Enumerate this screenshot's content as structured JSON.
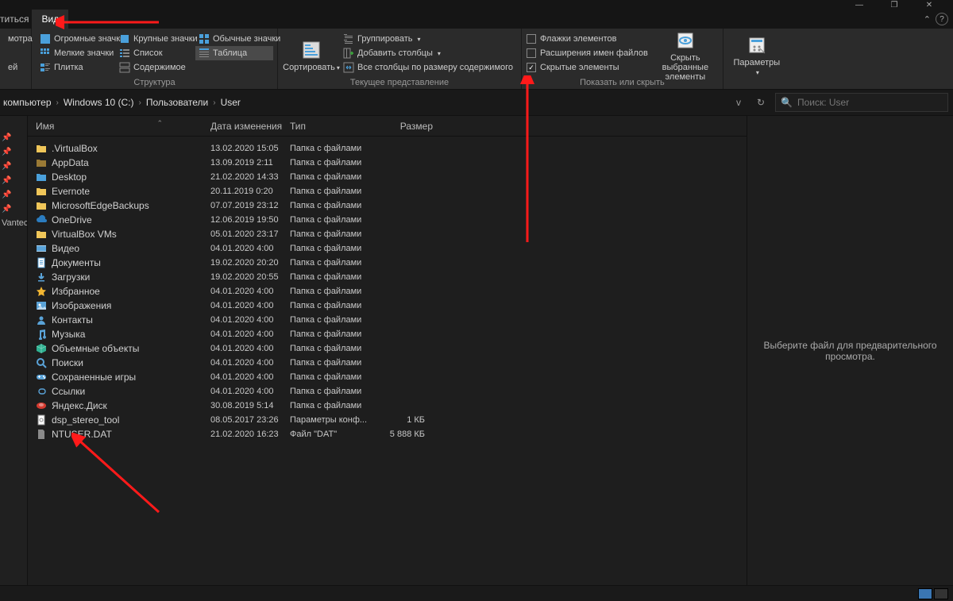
{
  "window": {
    "btn_minimize": "—",
    "btn_maximize": "❐",
    "btn_close": "✕"
  },
  "tabs": {
    "share_partial": "титься",
    "view": "Вид",
    "caret": "⌃",
    "help": "?"
  },
  "ribbon": {
    "sec_layout_label": "Структура",
    "sec_view_label": "Текущее представление",
    "sec_show_label": "Показать или скрыть",
    "pane_partial_1": "мотра",
    "pane_partial_2": "ей",
    "size_xl": "Огромные значки",
    "size_l": "Крупные значки",
    "size_m": "Обычные значки",
    "size_s": "Мелкие значки",
    "list": "Список",
    "table": "Таблица",
    "tiles": "Плитка",
    "content": "Содержимое",
    "sort": "Сортировать",
    "group": "Группировать",
    "add_cols": "Добавить столбцы",
    "autofit": "Все столбцы по размеру содержимого",
    "chk_flags": "Флажки элементов",
    "chk_ext": "Расширения имен файлов",
    "chk_hidden": "Скрытые элементы",
    "hide_selected_1": "Скрыть выбранные",
    "hide_selected_2": "элементы",
    "params": "Параметры"
  },
  "address": {
    "seg1": "компьютер",
    "seg2": "Windows 10 (C:)",
    "seg3": "Пользователи",
    "seg4": "User",
    "refresh": "↻",
    "drop": "v",
    "search_placeholder": "Поиск: User"
  },
  "columns": {
    "name": "Имя",
    "date": "Дата изменения",
    "type": "Тип",
    "size": "Размер"
  },
  "sidebar_partial": "Vantec",
  "files": [
    {
      "icon": "folder",
      "fill": "#f0c659",
      "name": ".VirtualBox",
      "date": "13.02.2020 15:05",
      "type": "Папка с файлами",
      "size": ""
    },
    {
      "icon": "folder",
      "fill": "#9a7a35",
      "name": "AppData",
      "date": "13.09.2019 2:11",
      "type": "Папка с файлами",
      "size": ""
    },
    {
      "icon": "folder",
      "fill": "#4aa0db",
      "name": "Desktop",
      "date": "21.02.2020 14:33",
      "type": "Папка с файлами",
      "size": ""
    },
    {
      "icon": "folder",
      "fill": "#f0c659",
      "name": "Evernote",
      "date": "20.11.2019 0:20",
      "type": "Папка с файлами",
      "size": ""
    },
    {
      "icon": "folder",
      "fill": "#f0c659",
      "name": "MicrosoftEdgeBackups",
      "date": "07.07.2019 23:12",
      "type": "Папка с файлами",
      "size": ""
    },
    {
      "icon": "cloud",
      "fill": "#2b7cbf",
      "name": "OneDrive",
      "date": "12.06.2019 19:50",
      "type": "Папка с файлами",
      "size": ""
    },
    {
      "icon": "folder",
      "fill": "#f0c659",
      "name": "VirtualBox VMs",
      "date": "05.01.2020 23:17",
      "type": "Папка с файлами",
      "size": ""
    },
    {
      "icon": "video",
      "fill": "#5aa3d8",
      "name": "Видео",
      "date": "04.01.2020 4:00",
      "type": "Папка с файлами",
      "size": ""
    },
    {
      "icon": "docs",
      "fill": "#5aa3d8",
      "name": "Документы",
      "date": "19.02.2020 20:20",
      "type": "Папка с файлами",
      "size": ""
    },
    {
      "icon": "download",
      "fill": "#5aa3d8",
      "name": "Загрузки",
      "date": "19.02.2020 20:55",
      "type": "Папка с файлами",
      "size": ""
    },
    {
      "icon": "star",
      "fill": "#f2b632",
      "name": "Избранное",
      "date": "04.01.2020 4:00",
      "type": "Папка с файлами",
      "size": ""
    },
    {
      "icon": "pictures",
      "fill": "#5aa3d8",
      "name": "Изображения",
      "date": "04.01.2020 4:00",
      "type": "Папка с файлами",
      "size": ""
    },
    {
      "icon": "contacts",
      "fill": "#5aa3d8",
      "name": "Контакты",
      "date": "04.01.2020 4:00",
      "type": "Папка с файлами",
      "size": ""
    },
    {
      "icon": "music",
      "fill": "#5aa3d8",
      "name": "Музыка",
      "date": "04.01.2020 4:00",
      "type": "Папка с файлами",
      "size": ""
    },
    {
      "icon": "3d",
      "fill": "#2fb191",
      "name": "Объемные объекты",
      "date": "04.01.2020 4:00",
      "type": "Папка с файлами",
      "size": ""
    },
    {
      "icon": "search",
      "fill": "#5aa3d8",
      "name": "Поиски",
      "date": "04.01.2020 4:00",
      "type": "Папка с файлами",
      "size": ""
    },
    {
      "icon": "games",
      "fill": "#5aa3d8",
      "name": "Сохраненные игры",
      "date": "04.01.2020 4:00",
      "type": "Папка с файлами",
      "size": ""
    },
    {
      "icon": "links",
      "fill": "#5aa3d8",
      "name": "Ссылки",
      "date": "04.01.2020 4:00",
      "type": "Папка с файлами",
      "size": ""
    },
    {
      "icon": "yadisk",
      "fill": "#d43a2f",
      "name": "Яндекс.Диск",
      "date": "30.08.2019 5:14",
      "type": "Папка с файлами",
      "size": ""
    },
    {
      "icon": "config",
      "fill": "#8a8a8a",
      "name": "dsp_stereo_tool",
      "date": "08.05.2017 23:26",
      "type": "Параметры конф...",
      "size": "1 КБ"
    },
    {
      "icon": "file",
      "fill": "#8a8a8a",
      "name": "NTUSER.DAT",
      "date": "21.02.2020 16:23",
      "type": "Файл \"DAT\"",
      "size": "5 888 КБ"
    }
  ],
  "preview_text": "Выберите файл для предварительного просмотра."
}
